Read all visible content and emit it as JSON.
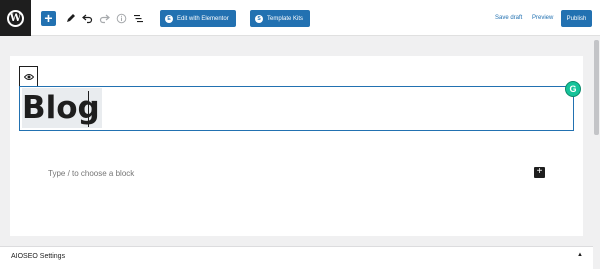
{
  "toolbar": {
    "wp_logo_letter": "W",
    "add_block_glyph": "+",
    "icons": [
      "wordpress-logo",
      "plus-icon",
      "pencil-icon",
      "undo-icon",
      "redo-icon",
      "info-icon",
      "list-view-icon"
    ],
    "elementor_label": "Edit with Elementor",
    "elementor_icon_glyph": "E",
    "template_kits_label": "Template Kits",
    "template_kits_icon_glyph": "S",
    "save_draft_label": "Save draft",
    "preview_label": "Preview",
    "publish_label": "Publish"
  },
  "editor": {
    "title": "Blog",
    "placeholder": "Type / to choose a block",
    "add_block_glyph": "+",
    "grammarly_glyph": "G"
  },
  "aioseo": {
    "title": "AIOSEO Settings",
    "toggle_glyph": "▲"
  },
  "colors": {
    "accent": "#2271b1",
    "dark": "#1e1e1e",
    "grammarly": "#15c39a"
  }
}
